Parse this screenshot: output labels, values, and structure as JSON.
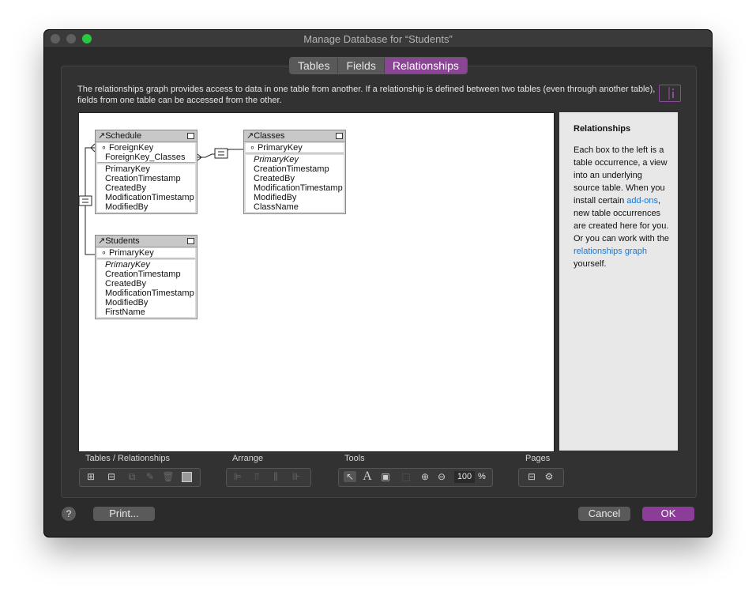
{
  "window": {
    "title": "Manage Database for “Students”"
  },
  "tabs": [
    {
      "label": "Tables"
    },
    {
      "label": "Fields"
    },
    {
      "label": "Relationships"
    }
  ],
  "description": "The relationships graph provides access to data in one table from another. If a relationship is defined between two tables (even through another table), fields from one table can be accessed from the other.",
  "table_occurrences": {
    "schedule": {
      "name": "Schedule",
      "keys": [
        "ForeignKey",
        "ForeignKey_Classes"
      ],
      "fields": [
        "PrimaryKey",
        "CreationTimestamp",
        "CreatedBy",
        "ModificationTimestamp",
        "ModifiedBy"
      ]
    },
    "classes": {
      "name": "Classes",
      "keys": [
        "PrimaryKey"
      ],
      "fields": [
        "PrimaryKey",
        "CreationTimestamp",
        "CreatedBy",
        "ModificationTimestamp",
        "ModifiedBy",
        "ClassName"
      ]
    },
    "students": {
      "name": "Students",
      "keys": [
        "PrimaryKey"
      ],
      "fields": [
        "PrimaryKey",
        "CreationTimestamp",
        "CreatedBy",
        "ModificationTimestamp",
        "ModifiedBy",
        "FirstName"
      ]
    }
  },
  "sidebar": {
    "heading": "Relationships",
    "body_1": "Each box to the left is a table occurrence, a view into an underlying source table. When you install certain ",
    "link_1": "add-ons",
    "body_2": ", new table occurrences are created here for you. Or you can work with the ",
    "link_2": "relationships graph",
    "body_3": " yourself."
  },
  "toolbar": {
    "tables_relationships_label": "Tables / Relationships",
    "arrange_label": "Arrange",
    "tools_label": "Tools",
    "pages_label": "Pages",
    "zoom_value": "100",
    "zoom_unit": "%"
  },
  "buttons": {
    "help": "?",
    "print": "Print...",
    "cancel": "Cancel",
    "ok": "OK"
  },
  "colors": {
    "accent": "#8b4595",
    "link": "#1a76d2",
    "close": "#ff5f57",
    "minimize": "#febc2e",
    "zoom": "#28c840"
  }
}
